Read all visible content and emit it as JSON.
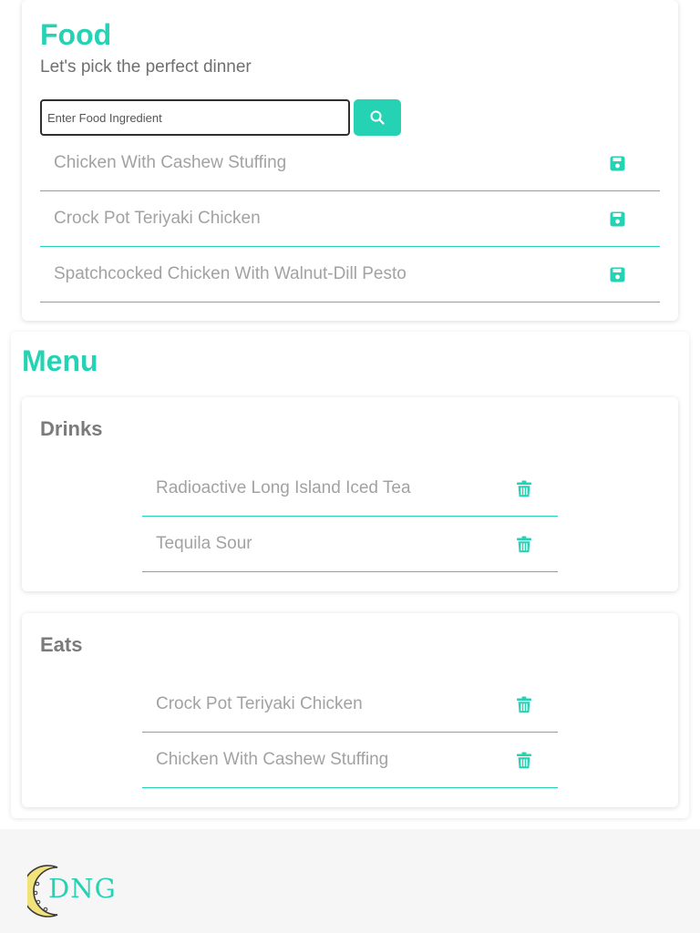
{
  "food": {
    "title": "Food",
    "subtitle": "Let's pick the perfect dinner",
    "search_placeholder": "Enter Food Ingredient",
    "search_icon": "search-icon",
    "results": [
      {
        "name": "Chicken With Cashew Stuffing",
        "icon": "save-icon"
      },
      {
        "name": "Crock Pot Teriyaki Chicken",
        "icon": "save-icon"
      },
      {
        "name": "Spatchcocked Chicken With Walnut-Dill Pesto",
        "icon": "save-icon"
      }
    ]
  },
  "menu": {
    "title": "Menu",
    "drinks": {
      "title": "Drinks",
      "items": [
        {
          "name": "Radioactive Long Island Iced Tea",
          "icon": "trash-icon"
        },
        {
          "name": "Tequila Sour",
          "icon": "trash-icon"
        }
      ]
    },
    "eats": {
      "title": "Eats",
      "items": [
        {
          "name": "Crock Pot Teriyaki Chicken",
          "icon": "trash-icon"
        },
        {
          "name": "Chicken With Cashew Stuffing",
          "icon": "trash-icon"
        }
      ]
    }
  },
  "footer": {
    "logo_text": "DNG"
  },
  "colors": {
    "accent": "#26d2b4",
    "title_gray": "#7b7b7b",
    "item_gray": "#a2a2a2",
    "logo_yellow": "#f2e27a"
  }
}
